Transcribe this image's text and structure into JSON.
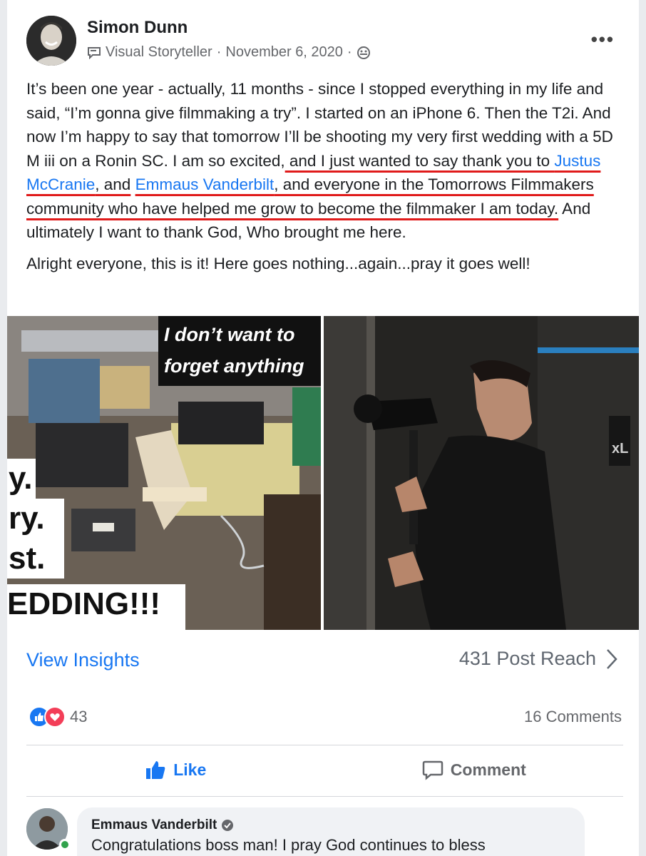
{
  "post": {
    "author": "Simon Dunn",
    "role": "Visual Storyteller",
    "date": "November 6, 2020",
    "separator": "·",
    "more": "•••",
    "body_1a": "It’s been one year - actually, 11 months - since I stopped everything in my life and said, “I’m gonna give filmmaking a try”. I started on an iPhone 6. Then the T2i. And now I’m happy to say that tomorrow I’ll be shooting my very first wedding with a 5D M iii on a Ronin SC. I am so excited,",
    "body_1b": " and I just wanted to say thank you to ",
    "mention_1": "Justus McCranie",
    "body_1c": ", and",
    "mention_2": "Emmaus Vanderbilt",
    "body_1d": ", and everyone in the Tomorrows Filmmakers community who have helped me grow to become the filmmaker I am today.",
    "body_1e": " And ultimately I want to thank God, Who brought me here.",
    "body_2": "Alright everyone, this is it! Here goes nothing...again...pray it goes well!"
  },
  "images": {
    "left_overlay_line1": "I don’t want to",
    "left_overlay_line2": "forget anything",
    "big_1": "y.",
    "big_2": "ry.",
    "big_3": "st.",
    "big_4": "EDDING!!!",
    "right_sign": "XL"
  },
  "insights": {
    "link": "View Insights",
    "reach": "431 Post Reach"
  },
  "stats": {
    "reaction_count": "43",
    "comments": "16 Comments"
  },
  "actions": {
    "like": "Like",
    "comment": "Comment"
  },
  "comment": {
    "author": "Emmaus Vanderbilt",
    "text": "Congratulations boss man! I pray God continues to bless"
  },
  "colors": {
    "link": "#1877f2",
    "underline": "#e01b1b",
    "love": "#f33e58",
    "online": "#31a24c"
  }
}
